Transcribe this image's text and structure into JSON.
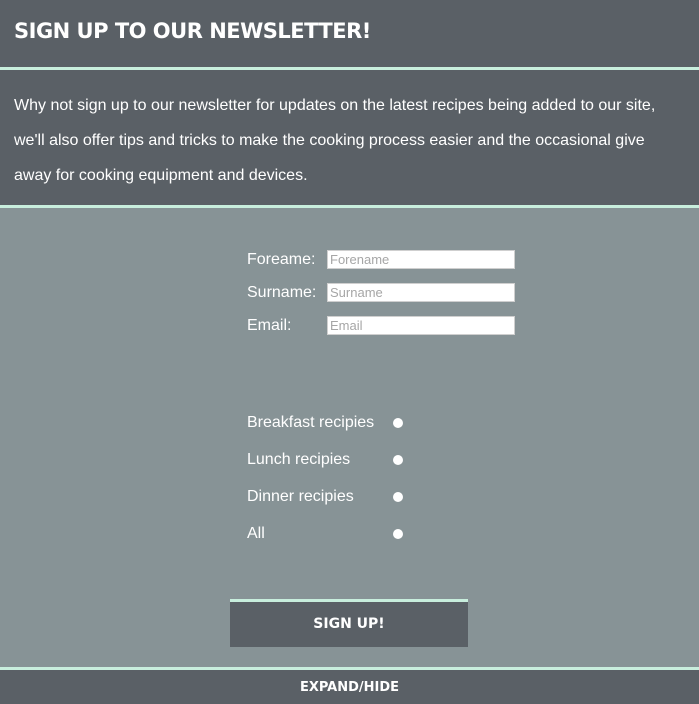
{
  "header": {
    "title": "SIGN UP TO OUR NEWSLETTER!"
  },
  "intro": {
    "text": "Why not sign up to our newsletter for updates on the latest recipes being added to our site, we'll also offer tips and tricks to make the cooking process easier and the occasional give away for cooking equipment and devices."
  },
  "form": {
    "forename": {
      "label": "Foreame:",
      "placeholder": "Forename",
      "value": ""
    },
    "surname": {
      "label": "Surname:",
      "placeholder": "Surname",
      "value": ""
    },
    "email": {
      "label": "Email:",
      "placeholder": "Email",
      "value": ""
    }
  },
  "radios": [
    {
      "label": "Breakfast recipies"
    },
    {
      "label": "Lunch recipies"
    },
    {
      "label": "Dinner recipies"
    },
    {
      "label": "All"
    }
  ],
  "signup_label": "SIGN UP!",
  "footer": {
    "toggle_label": "EXPAND/HIDE"
  },
  "colors": {
    "panel": "#5a6066",
    "body": "#879396",
    "accent": "#c8eedd"
  }
}
